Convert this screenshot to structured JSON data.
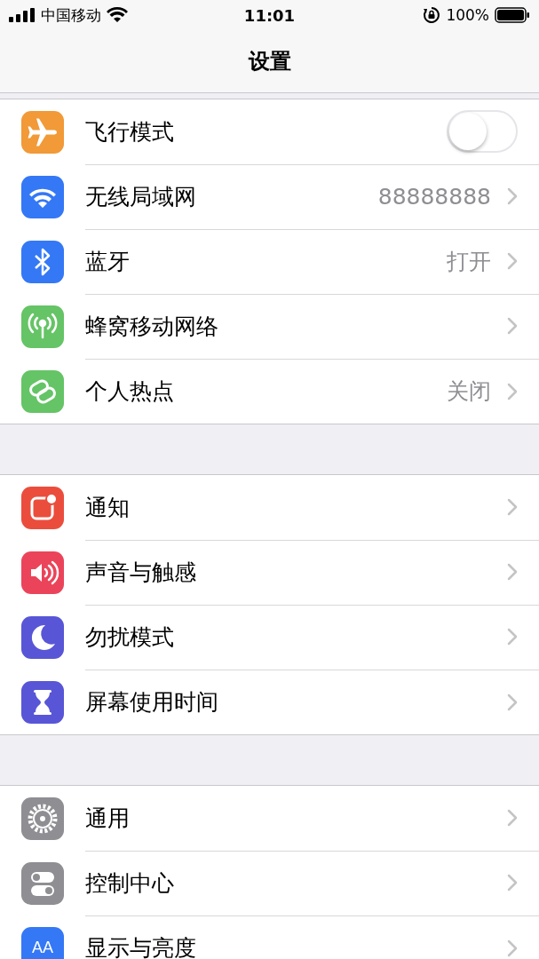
{
  "status_bar": {
    "carrier": "中国移动",
    "time": "11:01",
    "battery": "100%"
  },
  "nav": {
    "title": "设置"
  },
  "groups": [
    {
      "items": [
        {
          "label": "飞行模式",
          "kind": "toggle",
          "on": false,
          "color": "#f19a37"
        },
        {
          "label": "无线局域网",
          "kind": "link",
          "value": "88888888",
          "color": "#3478f6"
        },
        {
          "label": "蓝牙",
          "kind": "link",
          "value": "打开",
          "color": "#3478f6"
        },
        {
          "label": "蜂窝移动网络",
          "kind": "link",
          "color": "#65c466"
        },
        {
          "label": "个人热点",
          "kind": "link",
          "value": "关闭",
          "color": "#65c466"
        }
      ]
    },
    {
      "items": [
        {
          "label": "通知",
          "kind": "link",
          "color": "#eb4d3d"
        },
        {
          "label": "声音与触感",
          "kind": "link",
          "color": "#eb445a"
        },
        {
          "label": "勿扰模式",
          "kind": "link",
          "color": "#5856d6"
        },
        {
          "label": "屏幕使用时间",
          "kind": "link",
          "color": "#5856d6"
        }
      ]
    },
    {
      "items": [
        {
          "label": "通用",
          "kind": "link",
          "color": "#8e8e93"
        },
        {
          "label": "控制中心",
          "kind": "link",
          "color": "#8e8e93"
        },
        {
          "label": "显示与亮度",
          "kind": "link",
          "color": "#3478f6",
          "icon_text": "AA"
        }
      ]
    }
  ]
}
